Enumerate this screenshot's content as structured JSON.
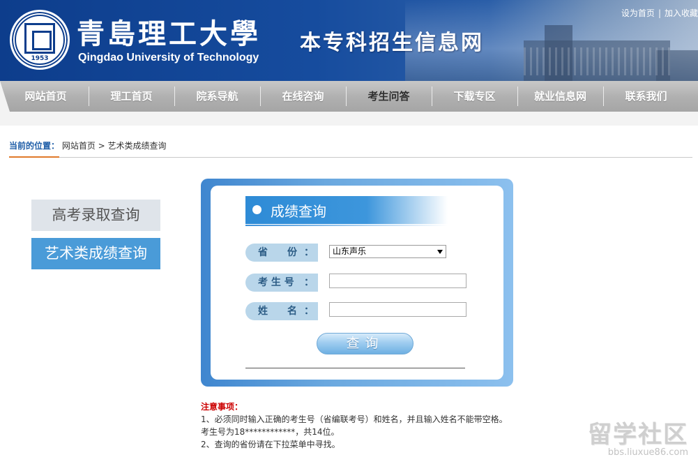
{
  "header": {
    "school_cn": "青島理工大學",
    "school_en": "Qingdao University of Technology",
    "logo_year": "1953",
    "site_title": "本专科招生信息网",
    "top_links": {
      "set_home": "设为首页",
      "add_fav": "加入收藏"
    }
  },
  "nav": {
    "items": [
      "网站首页",
      "理工首页",
      "院系导航",
      "在线咨询",
      "考生问答",
      "下载专区",
      "就业信息网",
      "联系我们"
    ],
    "active_index": 4
  },
  "breadcrumb": {
    "here_label": "当前的位置：",
    "home": "网站首页",
    "separator": " > ",
    "current": "艺术类成绩查询"
  },
  "side_menu": {
    "items": [
      "高考录取查询",
      "艺术类成绩查询"
    ],
    "active_index": 1
  },
  "query_form": {
    "title": "成绩查询",
    "province_label": "省　　份",
    "province_value": "山东声乐",
    "exam_no_label": "考 生 号",
    "name_label": "姓　　名",
    "colon": "：",
    "submit_label": "查询"
  },
  "notes": {
    "title": "注意事项：",
    "lines": [
      "1、必须同时输入正确的考生号（省编联考号）和姓名，并且输入姓名不能带空格。",
      "考生号为18************，共14位。",
      "2、查询的省份请在下拉菜单中寻找。"
    ]
  },
  "watermark": {
    "big": "留学社区",
    "small": "bbs.liuxue86.com"
  },
  "colors": {
    "header_blue": "#0d3d8c",
    "side_active": "#4a9bd8",
    "notes_title": "#cc0000"
  }
}
